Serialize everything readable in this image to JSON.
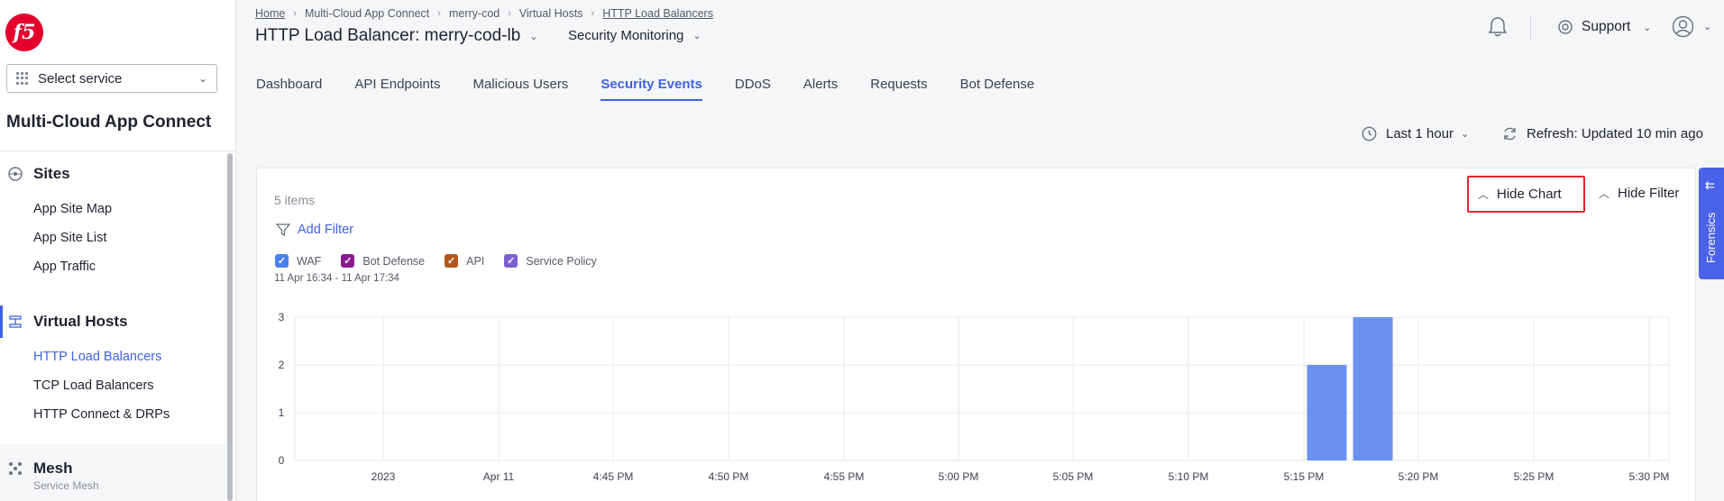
{
  "sidebar": {
    "logo_text": "f5",
    "service_select": "Select service",
    "product_title": "Multi-Cloud App Connect",
    "sections": {
      "sites": {
        "label": "Sites",
        "items": [
          "App Site Map",
          "App Site List",
          "App Traffic"
        ]
      },
      "virtual_hosts": {
        "label": "Virtual Hosts",
        "items": [
          "HTTP Load Balancers",
          "TCP Load Balancers",
          "HTTP Connect & DRPs"
        ],
        "active_item": "HTTP Load Balancers"
      },
      "mesh": {
        "label": "Mesh",
        "sublabel": "Service Mesh"
      }
    }
  },
  "header": {
    "breadcrumb": [
      "Home",
      "Multi-Cloud App Connect",
      "merry-cod",
      "Virtual Hosts",
      "HTTP Load Balancers"
    ],
    "title": "HTTP Load Balancer: merry-cod-lb",
    "mode": "Security Monitoring",
    "support_label": "Support"
  },
  "tabs": {
    "items": [
      "Dashboard",
      "API Endpoints",
      "Malicious Users",
      "Security Events",
      "DDoS",
      "Alerts",
      "Requests",
      "Bot Defense"
    ],
    "active": "Security Events"
  },
  "controls": {
    "time_range": "Last 1 hour",
    "refresh": "Refresh: Updated 10 min ago"
  },
  "panel": {
    "items_count": "5 items",
    "add_filter": "Add Filter",
    "hide_chart": "Hide Chart",
    "hide_filter": "Hide Filter",
    "forensics": "Forensics",
    "legend": [
      {
        "label": "WAF",
        "color": "#4a80ee"
      },
      {
        "label": "Bot Defense",
        "color": "#8b1a8f"
      },
      {
        "label": "API",
        "color": "#b3581c"
      },
      {
        "label": "Service Policy",
        "color": "#7b60d0"
      }
    ],
    "date_range": "11 Apr 16:34 - 11 Apr 17:34"
  },
  "chart_data": {
    "type": "bar",
    "x_ticks": [
      "2023",
      "Apr 11",
      "4:45 PM",
      "4:50 PM",
      "4:55 PM",
      "5:00 PM",
      "5:05 PM",
      "5:10 PM",
      "5:15 PM",
      "5:20 PM",
      "5:25 PM",
      "5:30 PM"
    ],
    "y_ticks": [
      0,
      1,
      2,
      3
    ],
    "ylim": [
      0,
      3
    ],
    "bars": [
      {
        "x": "5:16 PM",
        "value": 2
      },
      {
        "x": "5:18 PM",
        "value": 3
      }
    ],
    "bar_color": "#6a91f2",
    "grid": true
  }
}
